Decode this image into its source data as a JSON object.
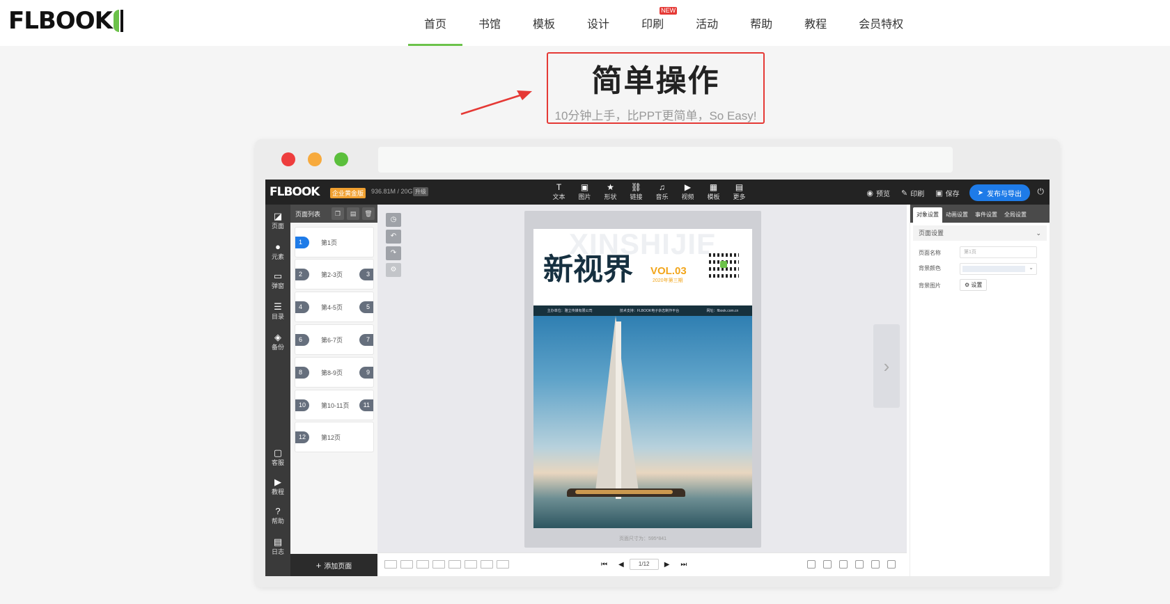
{
  "brand": {
    "logo_text": "FLBOOK"
  },
  "nav": {
    "items": [
      {
        "label": "首页",
        "active": true
      },
      {
        "label": "书馆"
      },
      {
        "label": "模板"
      },
      {
        "label": "设计"
      },
      {
        "label": "印刷",
        "badge": "NEW"
      },
      {
        "label": "活动"
      },
      {
        "label": "帮助"
      },
      {
        "label": "教程"
      },
      {
        "label": "会员特权"
      }
    ],
    "accent_color": "#6cc24a"
  },
  "hero": {
    "title": "简单操作",
    "subtitle": "10分钟上手，比PPT更简单，So Easy!",
    "highlight_color": "#e53935"
  },
  "editor": {
    "logo_text": "FLBOOK",
    "plan_tag": "企业黄金版",
    "storage": "936.81M / 20G",
    "upgrade": "升级",
    "tools": [
      {
        "label": "文本",
        "icon": "T"
      },
      {
        "label": "图片",
        "icon": "▣"
      },
      {
        "label": "形状",
        "icon": "★"
      },
      {
        "label": "链接",
        "icon": "⛓"
      },
      {
        "label": "音乐",
        "icon": "♫"
      },
      {
        "label": "视频",
        "icon": "▶"
      },
      {
        "label": "模板",
        "icon": "▦"
      },
      {
        "label": "更多",
        "icon": "▤"
      }
    ],
    "actions": {
      "preview": "预览",
      "print": "印刷",
      "save": "保存",
      "publish": "发布与导出"
    },
    "rail": [
      {
        "label": "页面",
        "icon": "◪"
      },
      {
        "label": "元素",
        "icon": "●"
      },
      {
        "label": "弹窗",
        "icon": "▭"
      },
      {
        "label": "目录",
        "icon": "☰"
      },
      {
        "label": "备份",
        "icon": "◈"
      },
      {
        "label": "客服",
        "icon": "▢"
      },
      {
        "label": "教程",
        "icon": "▶"
      },
      {
        "label": "帮助",
        "icon": "?"
      },
      {
        "label": "日志",
        "icon": "▤"
      }
    ],
    "pages_panel": {
      "title": "页面列表",
      "add_label": "添加页面",
      "pages": [
        {
          "num": "1",
          "label": "第1页",
          "active": true
        },
        {
          "num": "2",
          "num2": "3",
          "label": "第2-3页"
        },
        {
          "num": "4",
          "num2": "5",
          "label": "第4-5页"
        },
        {
          "num": "6",
          "num2": "7",
          "label": "第6-7页"
        },
        {
          "num": "8",
          "num2": "9",
          "label": "第8-9页"
        },
        {
          "num": "10",
          "num2": "11",
          "label": "第10-11页"
        },
        {
          "num": "12",
          "label": "第12页"
        }
      ]
    },
    "magazine": {
      "ghost_text": "XINSHIJIE",
      "title": "新视界",
      "vol": "VOL.03",
      "issue": "2020年第三期",
      "bar_left": "主办单位：雅立传媒有限公司",
      "bar_mid": "技术支持：FLBOOK电子杂志制作平台",
      "bar_right": "网址：flbook.com.cn"
    },
    "page_size": "页面尺寸为：595*841",
    "pager": {
      "current": "1/12"
    },
    "props": {
      "tabs": [
        "对象设置",
        "动画设置",
        "事件设置",
        "全局设置"
      ],
      "section": "页面设置",
      "page_name_label": "页面名称",
      "page_name_placeholder": "第1页",
      "bg_color_label": "背景颜色",
      "bg_image_label": "背景图片",
      "set_button": "设置"
    }
  }
}
